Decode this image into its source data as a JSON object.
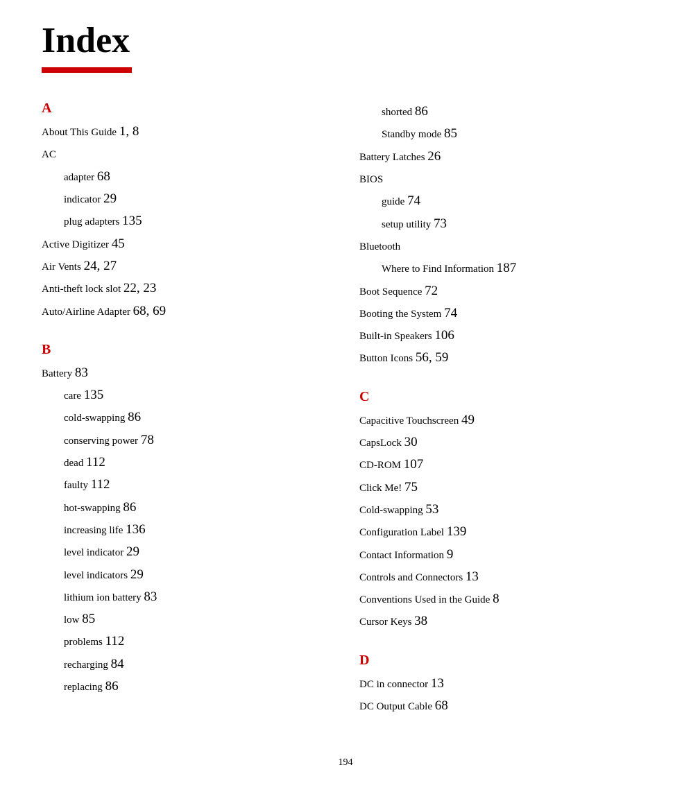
{
  "title": "Index",
  "redbar": true,
  "left_column": {
    "sections": [
      {
        "letter": "A",
        "entries": [
          {
            "term": "About This Guide ",
            "num": "1, 8",
            "indent": false
          },
          {
            "term": "AC",
            "num": "",
            "indent": false
          },
          {
            "term": "adapter ",
            "num": "68",
            "indent": true
          },
          {
            "term": "indicator ",
            "num": "29",
            "indent": true
          },
          {
            "term": "plug adapters ",
            "num": "135",
            "indent": true
          },
          {
            "term": "Active Digitizer ",
            "num": "45",
            "indent": false
          },
          {
            "term": "Air Vents ",
            "num": "24, 27",
            "indent": false
          },
          {
            "term": "Anti-theft lock slot ",
            "num": "22, 23",
            "indent": false
          },
          {
            "term": "Auto/Airline Adapter ",
            "num": "68, 69",
            "indent": false
          }
        ]
      },
      {
        "letter": "B",
        "entries": [
          {
            "term": "Battery ",
            "num": "83",
            "indent": false
          },
          {
            "term": "care ",
            "num": "135",
            "indent": true
          },
          {
            "term": "cold-swapping ",
            "num": "86",
            "indent": true
          },
          {
            "term": "conserving power ",
            "num": "78",
            "indent": true
          },
          {
            "term": "dead ",
            "num": "112",
            "indent": true
          },
          {
            "term": "faulty ",
            "num": "112",
            "indent": true
          },
          {
            "term": "hot-swapping ",
            "num": "86",
            "indent": true
          },
          {
            "term": "increasing life ",
            "num": "136",
            "indent": true
          },
          {
            "term": "level indicator ",
            "num": "29",
            "indent": true
          },
          {
            "term": "level indicators ",
            "num": "29",
            "indent": true
          },
          {
            "term": "lithium ion battery ",
            "num": "83",
            "indent": true
          },
          {
            "term": "low ",
            "num": "85",
            "indent": true
          },
          {
            "term": "problems ",
            "num": "112",
            "indent": true
          },
          {
            "term": "recharging ",
            "num": "84",
            "indent": true
          },
          {
            "term": "replacing ",
            "num": "86",
            "indent": true
          }
        ]
      }
    ]
  },
  "right_column": {
    "sections": [
      {
        "letter": "",
        "entries": [
          {
            "term": "shorted ",
            "num": "86",
            "indent": true
          },
          {
            "term": "Standby mode ",
            "num": "85",
            "indent": true
          },
          {
            "term": "Battery Latches ",
            "num": "26",
            "indent": false
          },
          {
            "term": "BIOS",
            "num": "",
            "indent": false
          },
          {
            "term": "guide ",
            "num": "74",
            "indent": true
          },
          {
            "term": "setup utility ",
            "num": "73",
            "indent": true
          },
          {
            "term": "Bluetooth",
            "num": "",
            "indent": false
          },
          {
            "term": "Where to Find Information ",
            "num": "187",
            "indent": true
          },
          {
            "term": "Boot Sequence ",
            "num": "72",
            "indent": false
          },
          {
            "term": "Booting the System ",
            "num": "74",
            "indent": false
          },
          {
            "term": "Built-in Speakers ",
            "num": "106",
            "indent": false
          },
          {
            "term": "Button Icons ",
            "num": "56, 59",
            "indent": false
          }
        ]
      },
      {
        "letter": "C",
        "entries": [
          {
            "term": "Capacitive Touchscreen ",
            "num": "49",
            "indent": false
          },
          {
            "term": "CapsLock ",
            "num": "30",
            "indent": false
          },
          {
            "term": "CD-ROM ",
            "num": "107",
            "indent": false
          },
          {
            "term": "Click Me! ",
            "num": "75",
            "indent": false
          },
          {
            "term": "Cold-swapping ",
            "num": "53",
            "indent": false
          },
          {
            "term": "Configuration Label ",
            "num": "139",
            "indent": false
          },
          {
            "term": "Contact Information ",
            "num": "9",
            "indent": false
          },
          {
            "term": "Controls and Connectors ",
            "num": "13",
            "indent": false
          },
          {
            "term": "Conventions Used in the Guide ",
            "num": "8",
            "indent": false
          },
          {
            "term": "Cursor Keys ",
            "num": "38",
            "indent": false
          }
        ]
      },
      {
        "letter": "D",
        "entries": [
          {
            "term": "DC in connector ",
            "num": "13",
            "indent": false
          },
          {
            "term": "DC Output Cable ",
            "num": "68",
            "indent": false
          }
        ]
      }
    ]
  },
  "page_number": "194"
}
